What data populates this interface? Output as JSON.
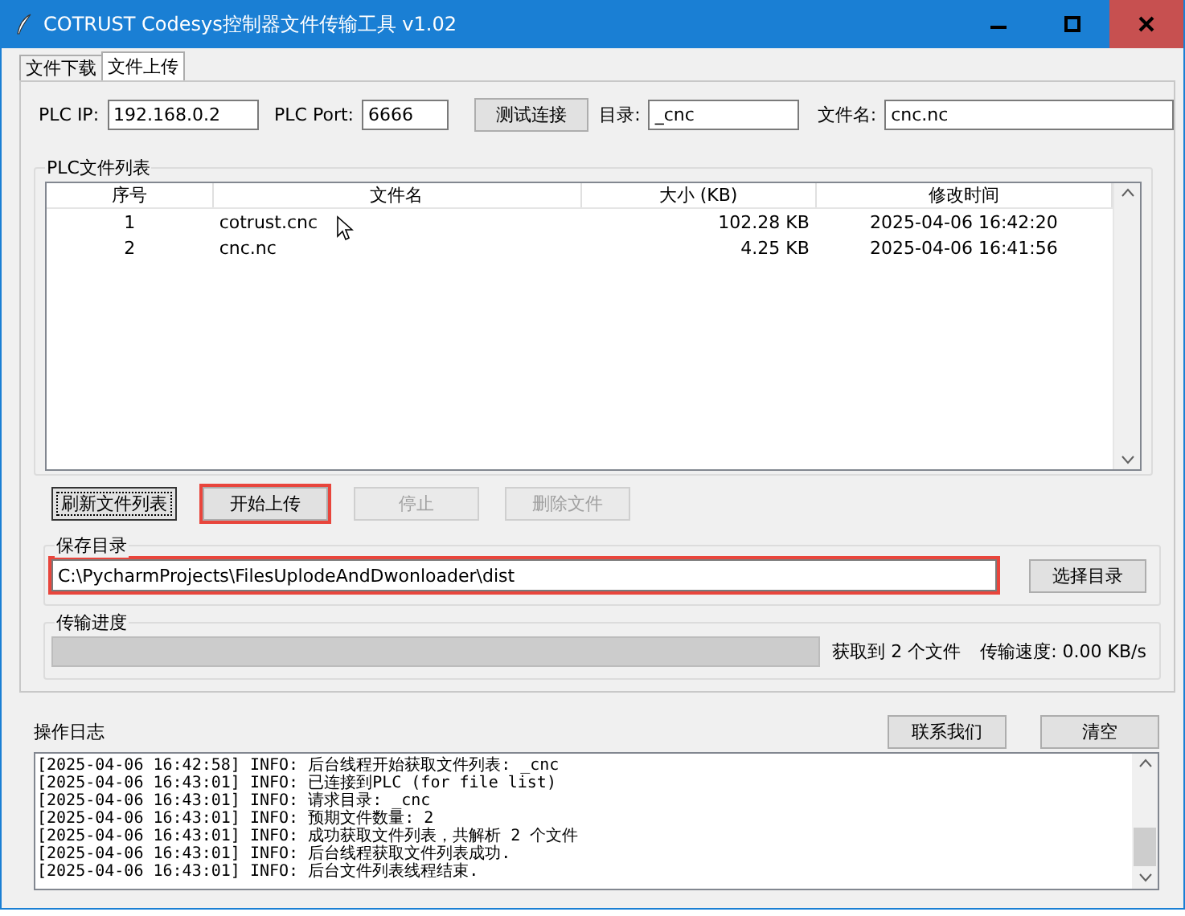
{
  "window": {
    "title": "COTRUST Codesys控制器文件传输工具 v1.02"
  },
  "tabs": [
    {
      "label": "文件下载",
      "selected": false
    },
    {
      "label": "文件上传",
      "selected": true
    }
  ],
  "connection": {
    "ip_label": "PLC IP:",
    "ip": "192.168.0.2",
    "port_label": "PLC Port:",
    "port": "6666",
    "test_button": "测试连接",
    "dir_label": "目录:",
    "dir": "_cnc",
    "file_label": "文件名:",
    "file": "cnc.nc"
  },
  "file_list": {
    "title": "PLC文件列表",
    "columns": [
      "序号",
      "文件名",
      "大小 (KB)",
      "修改时间"
    ],
    "rows": [
      [
        "1",
        "cotrust.cnc",
        "102.28 KB",
        "2025-04-06 16:42:20"
      ],
      [
        "2",
        "cnc.nc",
        "4.25 KB",
        "2025-04-06 16:41:56"
      ]
    ]
  },
  "actions": [
    {
      "label": "刷新文件列表",
      "disabled": false,
      "focused": true,
      "highlighted": false
    },
    {
      "label": "开始上传",
      "disabled": false,
      "focused": false,
      "highlighted": true
    },
    {
      "label": "停止",
      "disabled": true,
      "focused": false,
      "highlighted": false
    },
    {
      "label": "删除文件",
      "disabled": true,
      "focused": false,
      "highlighted": false
    }
  ],
  "save_dir": {
    "title": "保存目录",
    "path": "C:\\PycharmProjects\\FilesUplodeAndDwonloader\\dist",
    "highlighted": true,
    "browse_button": "选择目录"
  },
  "progress": {
    "title": "传输进度",
    "level": 0,
    "status": "获取到 2 个文件",
    "speed": "传输速度: 0.00 KB/s"
  },
  "log": {
    "title": "操作日志",
    "buttons": [
      "联系我们",
      "清空"
    ],
    "lines": [
      "[2025-04-06 16:42:58] INFO: 后台线程开始获取文件列表: _cnc",
      "[2025-04-06 16:43:01] INFO: 已连接到PLC (for file list)",
      "[2025-04-06 16:43:01] INFO: 请求目录: _cnc",
      "[2025-04-06 16:43:01] INFO: 预期文件数量: 2",
      "[2025-04-06 16:43:01] INFO: 成功获取文件列表，共解析 2 个文件",
      "[2025-04-06 16:43:01] INFO: 后台线程获取文件列表成功.",
      "[2025-04-06 16:43:01] INFO: 后台文件列表线程结束."
    ]
  }
}
